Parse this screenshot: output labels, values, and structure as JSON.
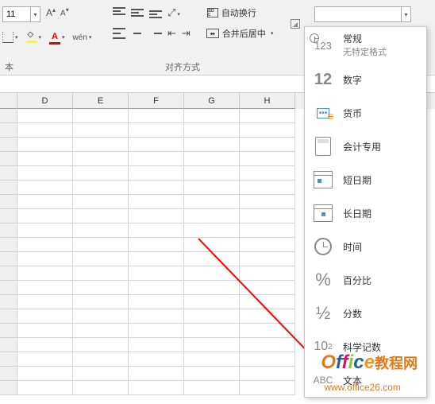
{
  "ribbon": {
    "font_size": "11",
    "grow_label": "A",
    "shrink_label": "A",
    "wen_label": "wén",
    "font_group_label": "本",
    "align_group_label": "对齐方式",
    "wrap_text_label": "自动换行",
    "merge_label": "合并后居中",
    "number_format_value": ""
  },
  "formats": [
    {
      "icon": "123",
      "title": "常规",
      "sub": "无特定格式"
    },
    {
      "icon": "12",
      "title": "数字",
      "sub": ""
    },
    {
      "icon": "money",
      "title": "货币",
      "sub": ""
    },
    {
      "icon": "calc",
      "title": "会计专用",
      "sub": ""
    },
    {
      "icon": "date-short",
      "title": "短日期",
      "sub": ""
    },
    {
      "icon": "date-long",
      "title": "长日期",
      "sub": ""
    },
    {
      "icon": "clock",
      "title": "时间",
      "sub": ""
    },
    {
      "icon": "%",
      "title": "百分比",
      "sub": ""
    },
    {
      "icon": "½",
      "title": "分数",
      "sub": ""
    },
    {
      "icon": "10²",
      "title": "科学记数",
      "sub": ""
    },
    {
      "icon": "ABC",
      "title": "文本",
      "sub": ""
    }
  ],
  "columns": [
    "",
    "D",
    "E",
    "F",
    "G",
    "H"
  ],
  "watermark": {
    "text": "Office教程网",
    "url": "www.office26.com"
  }
}
